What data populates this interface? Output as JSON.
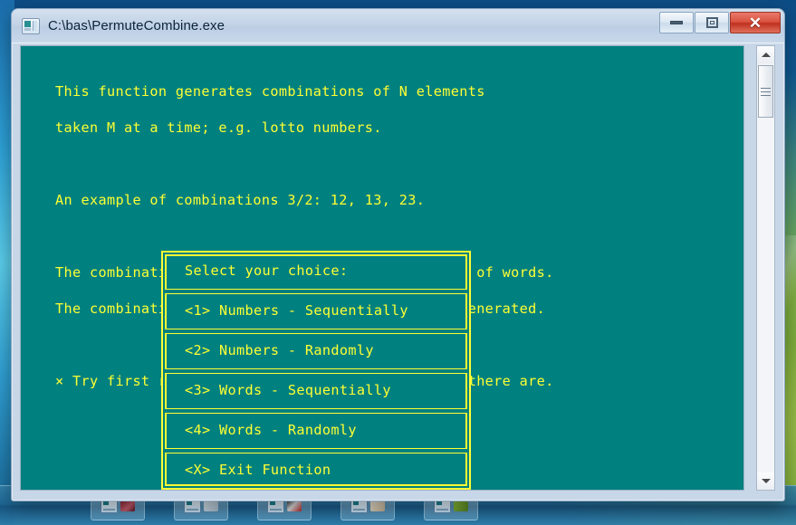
{
  "window": {
    "title": "C:\\bas\\PermuteCombine.exe",
    "icon": "console-app-icon",
    "controls": {
      "minimize": "minimize-button",
      "maximize": "restore-button",
      "close": "✕"
    }
  },
  "colors": {
    "console_background": "#00807f",
    "console_foreground": "#ffff33",
    "titlebar": "#c3d3e6",
    "close_button": "#d9533f"
  },
  "console": {
    "lines": [
      "This function generates combinations of N elements",
      "taken M at a time; e.g. lotto numbers.",
      "",
      "An example of combinations 3/2: 12, 13, 23.",
      "",
      "The combinations can be numerical or be composed of words.",
      "The combinations can be sequential or randomly generated.",
      "",
      "× Try first random numbers to see how many sets there are."
    ],
    "menu": {
      "prompt": "Select your choice:",
      "options": [
        "<1> Numbers - Sequentially",
        "<2> Numbers - Randomly",
        "<3> Words - Sequentially",
        "<4> Words - Randomly",
        "<X> Exit Function"
      ]
    }
  },
  "scrollbar": {
    "up_arrow": "scroll-up-arrow",
    "down_arrow": "scroll-down-arrow",
    "thumb": "scroll-thumb"
  }
}
